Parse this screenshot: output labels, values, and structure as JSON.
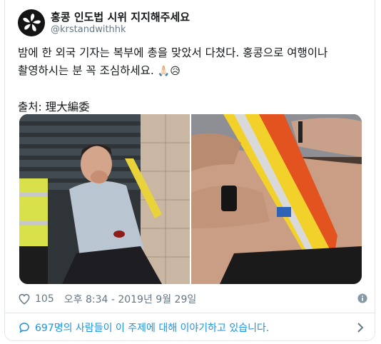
{
  "author": {
    "display_name": "홍콩 인도법 시위 지지해주세요",
    "handle": "@krstandwithhk"
  },
  "tweet": {
    "line1": "밤에 한 외국 기자는 복부에 총을 맞았서 다쳤다. 홍콩으로 여행이나",
    "line2": "촬영하시는 분 꼭 조심하세요.",
    "emoji_pray": "🙏🏻",
    "emoji_sad": "😥",
    "source": "출처: 理大編委"
  },
  "meta": {
    "like_count": "105",
    "timestamp": "오후 8:34 - 2019년 9월 29일"
  },
  "conversation": {
    "label": "697명의 사람들이 이 주제에 대해 이야기하고 있습니다."
  },
  "colors": {
    "link": "#1b95e0",
    "muted": "#657786",
    "border": "#e1e8ed"
  }
}
